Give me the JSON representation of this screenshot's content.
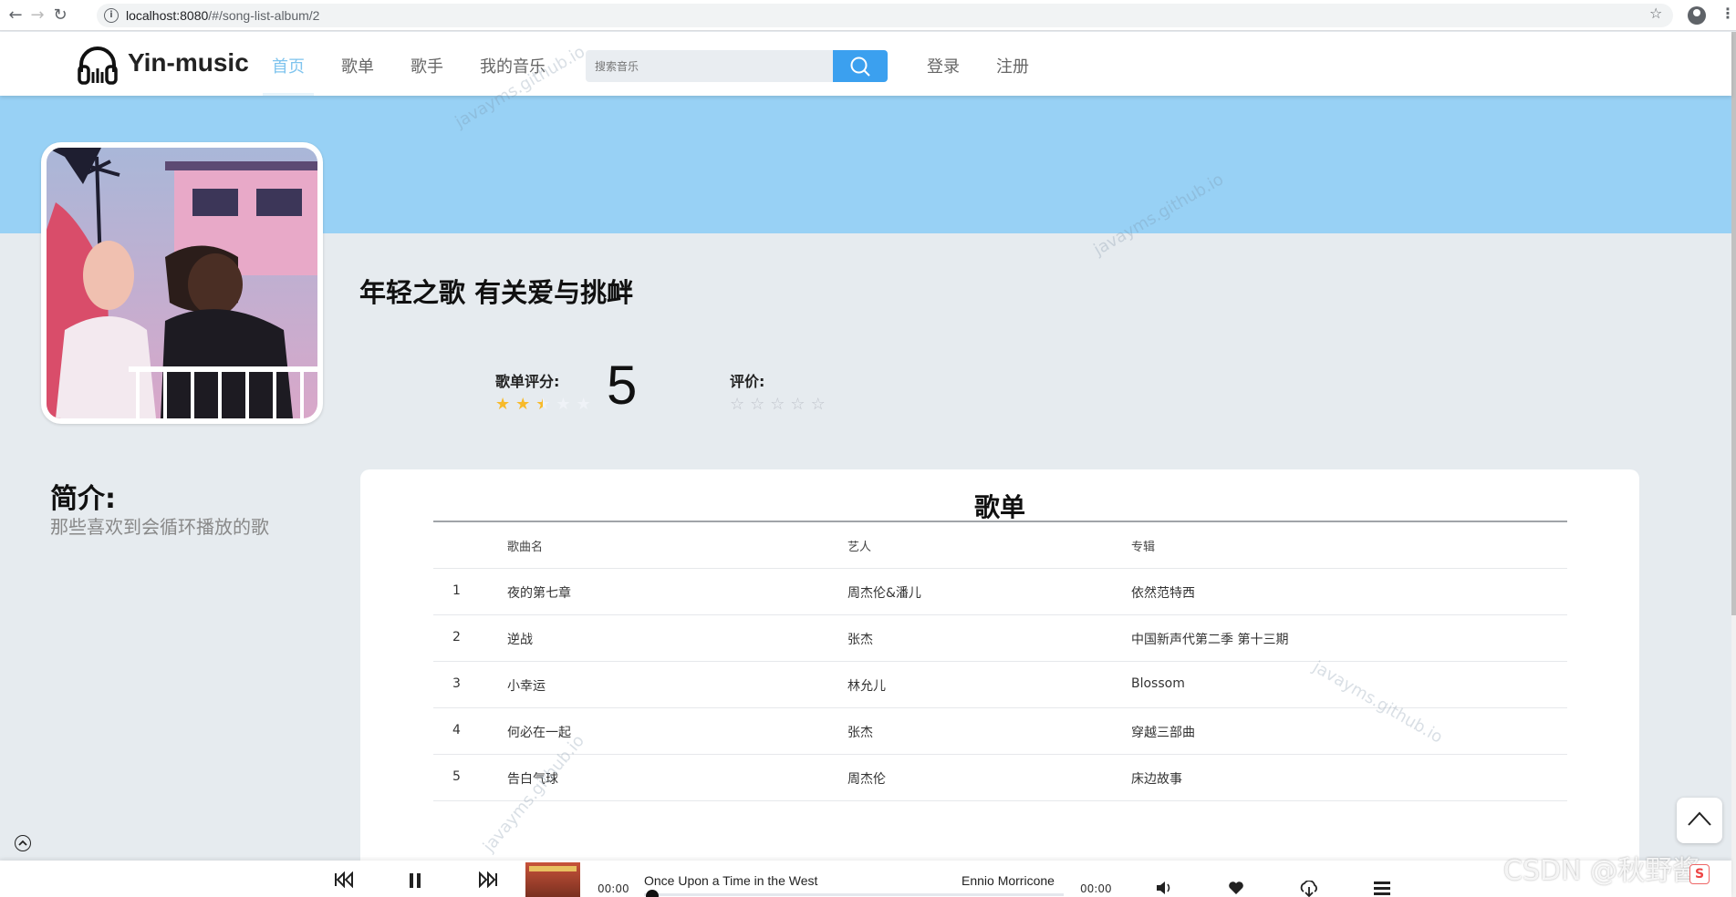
{
  "browser": {
    "url_host": "localhost:8080",
    "url_path": "/#/song-list-album/2"
  },
  "header": {
    "brand": "Yin-music",
    "nav": [
      "首页",
      "歌单",
      "歌手",
      "我的音乐"
    ],
    "active_nav": "首页",
    "search_placeholder": "搜索音乐",
    "login": "登录",
    "register": "注册"
  },
  "album": {
    "title": "年轻之歌 有关爱与挑衅",
    "score_label": "歌单评分:",
    "score_value": "5",
    "score_stars": 2.5,
    "score_max": 5,
    "rate_label": "评价:",
    "rate_stars": 0
  },
  "intro": {
    "title": "简介:",
    "text": "那些喜欢到会循环播放的歌"
  },
  "songlist": {
    "title": "歌单",
    "columns": [
      "",
      "歌曲名",
      "艺人",
      "专辑"
    ],
    "rows": [
      [
        "1",
        "夜的第七章",
        "周杰伦&潘儿",
        "依然范特西"
      ],
      [
        "2",
        "逆战",
        "张杰",
        "中国新声代第二季 第十三期"
      ],
      [
        "3",
        "小幸运",
        "林允儿",
        "Blossom"
      ],
      [
        "4",
        "何必在一起",
        "张杰",
        "穿越三部曲"
      ],
      [
        "5",
        "告白气球",
        "周杰伦",
        "床边故事"
      ]
    ]
  },
  "player": {
    "time_current": "00:00",
    "time_total": "00:00",
    "song": "Once Upon a Time in the West",
    "artist": "Ennio Morricone",
    "progress": 0
  },
  "watermark": "javayms.github.io",
  "overlay": {
    "csdn": "CSDN @秋野酱"
  }
}
